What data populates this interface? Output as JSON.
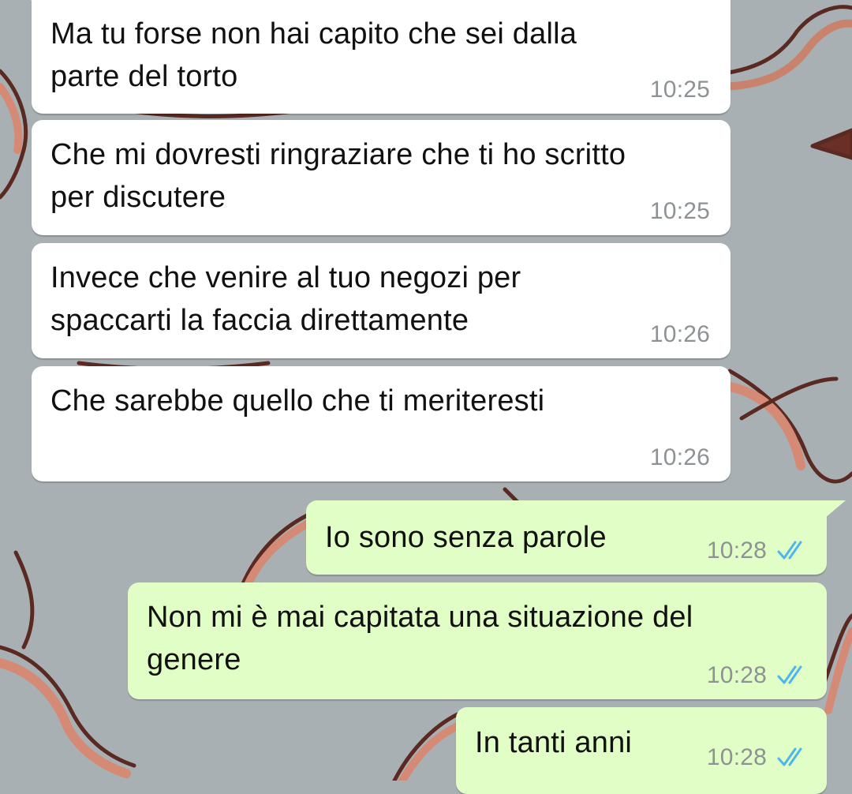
{
  "messages": [
    {
      "direction": "incoming",
      "text": "Ma tu forse non hai capito che sei dalla\nparte del torto",
      "time": "10:25"
    },
    {
      "direction": "incoming",
      "text": "Che mi dovresti ringraziare che ti ho scritto\nper discutere",
      "time": "10:25"
    },
    {
      "direction": "incoming",
      "text": "Invece che venire al tuo negozi per\nspaccarti la faccia direttamente",
      "time": "10:26"
    },
    {
      "direction": "incoming",
      "text": "Che sarebbe quello che ti meriteresti",
      "time": "10:26"
    },
    {
      "direction": "outgoing",
      "text": "Io sono senza parole",
      "time": "10:28",
      "status_icon": "double-check-read-icon"
    },
    {
      "direction": "outgoing",
      "text": "Non mi è mai capitata una situazione del\ngenere",
      "time": "10:28",
      "status_icon": "double-check-read-icon"
    },
    {
      "direction": "outgoing",
      "text": "In tanti anni",
      "time": "10:28",
      "status_icon": "double-check-read-icon"
    }
  ],
  "colors": {
    "incoming_bubble": "#ffffff",
    "outgoing_bubble": "#e1fec6",
    "timestamp": "#8d9294",
    "read_ticks": "#4fb6ec",
    "wallpaper": "#a9b0b3"
  }
}
